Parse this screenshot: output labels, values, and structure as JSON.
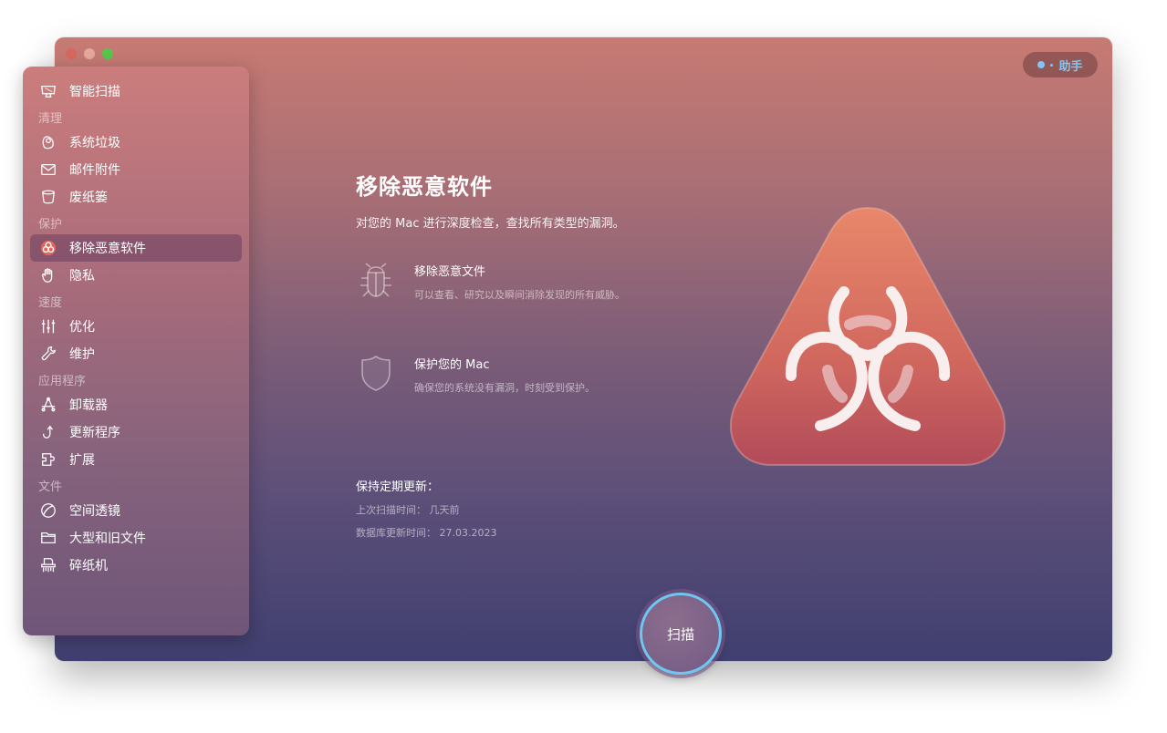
{
  "window": {
    "traffic_lights": [
      "close",
      "minimize",
      "maximize"
    ],
    "assistant_label": "助手"
  },
  "sidebar": {
    "top_item": {
      "label": "智能扫描",
      "icon": "monitor-icon"
    },
    "sections": [
      {
        "title": "清理",
        "items": [
          {
            "label": "系统垃圾",
            "icon": "system-junk-icon"
          },
          {
            "label": "邮件附件",
            "icon": "mail-icon"
          },
          {
            "label": "废纸篓",
            "icon": "trash-icon"
          }
        ]
      },
      {
        "title": "保护",
        "items": [
          {
            "label": "移除恶意软件",
            "icon": "biohazard-icon",
            "active": true
          },
          {
            "label": "隐私",
            "icon": "hand-icon"
          }
        ]
      },
      {
        "title": "速度",
        "items": [
          {
            "label": "优化",
            "icon": "sliders-icon"
          },
          {
            "label": "维护",
            "icon": "wrench-icon"
          }
        ]
      },
      {
        "title": "应用程序",
        "items": [
          {
            "label": "卸载器",
            "icon": "uninstaller-icon"
          },
          {
            "label": "更新程序",
            "icon": "updater-icon"
          },
          {
            "label": "扩展",
            "icon": "extension-icon"
          }
        ]
      },
      {
        "title": "文件",
        "items": [
          {
            "label": "空间透镜",
            "icon": "space-lens-icon"
          },
          {
            "label": "大型和旧文件",
            "icon": "folder-icon"
          },
          {
            "label": "碎纸机",
            "icon": "shredder-icon"
          }
        ]
      }
    ]
  },
  "main": {
    "title": "移除恶意软件",
    "subtitle": "对您的 Mac 进行深度检查，查找所有类型的漏洞。",
    "features": [
      {
        "title": "移除恶意文件",
        "desc": "可以查看、研究以及瞬间消除发现的所有威胁。",
        "icon": "bug-icon"
      },
      {
        "title": "保护您的 Mac",
        "desc": "确保您的系统没有漏洞，时刻受到保护。",
        "icon": "shield-icon"
      }
    ],
    "update": {
      "title": "保持定期更新：",
      "last_scan": "上次扫描时间： 几天前",
      "db_update": "数据库更新时间： 27.03.2023"
    },
    "scan_button": "扫描"
  },
  "colors": {
    "accent_blue": "#6fc6f0",
    "hero_top": "#e6856a",
    "hero_bottom": "#b24b5a"
  }
}
